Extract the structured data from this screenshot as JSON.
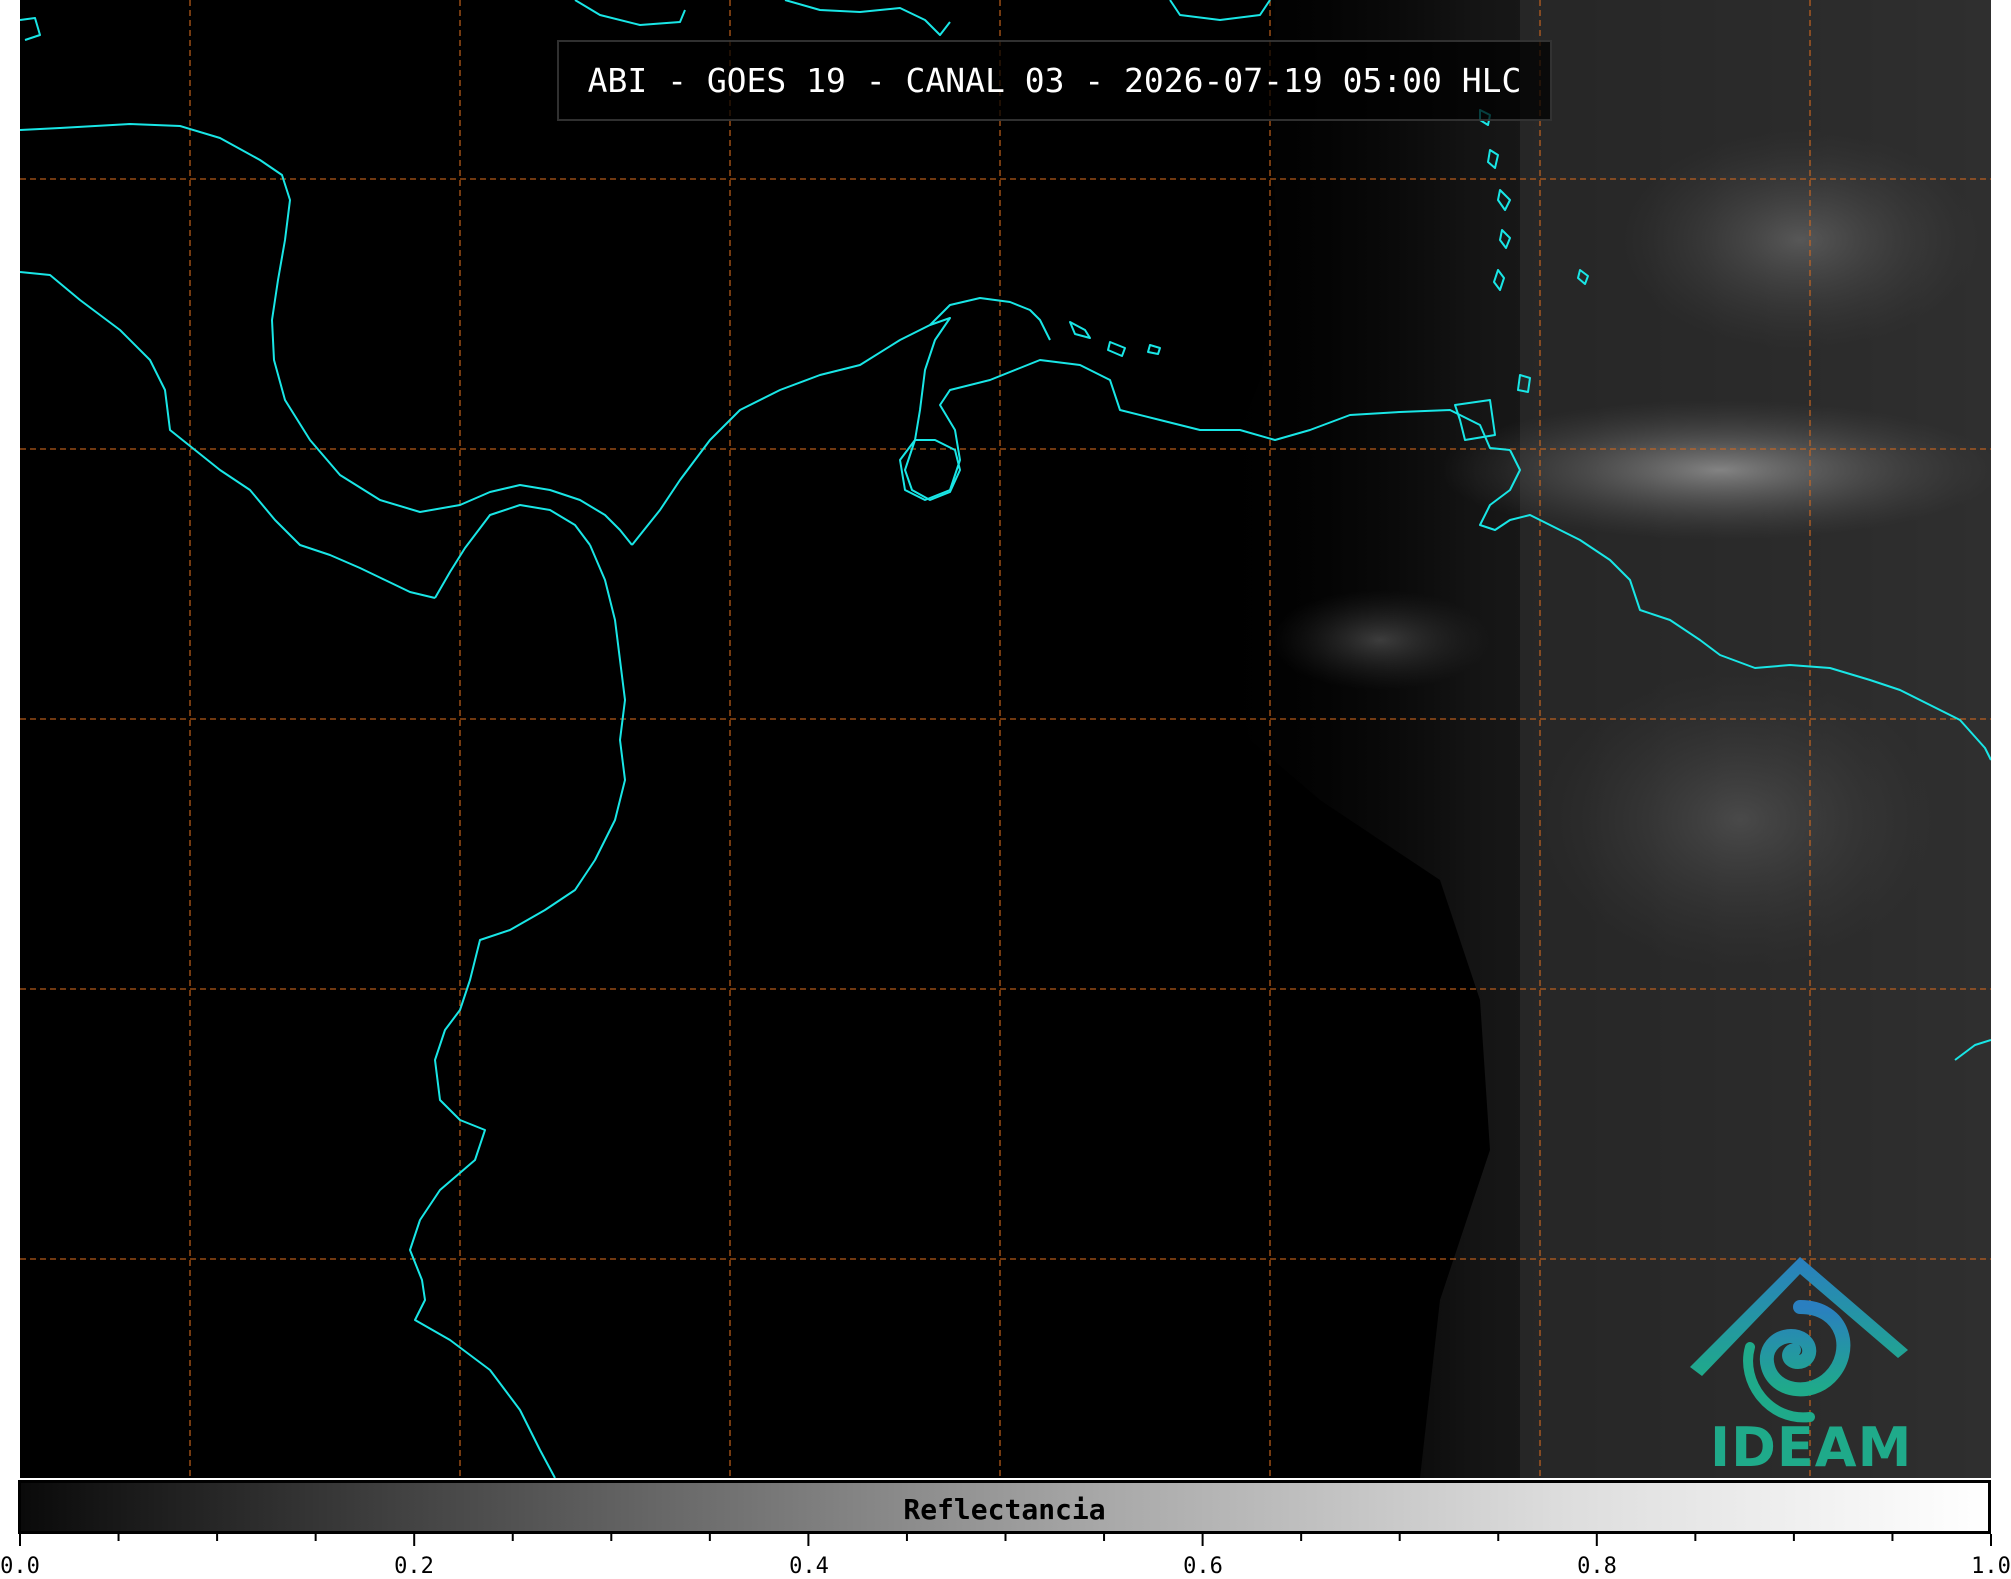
{
  "title": "ABI - GOES 19 - CANAL 03 - 2026-07-19 05:00 HLC",
  "colorbar": {
    "label": "Reflectancia",
    "min": 0.0,
    "max": 1.0,
    "tick_labels": [
      "0.0",
      "0.2",
      "0.4",
      "0.6",
      "0.8",
      "1.0"
    ]
  },
  "logo": {
    "text": "IDEAM",
    "colors": {
      "blue": "#2a7fc0",
      "teal": "#1faa8a"
    }
  },
  "colors": {
    "background": "#000000",
    "coastline": "#19e6e6",
    "graticule": "#d2691e"
  }
}
